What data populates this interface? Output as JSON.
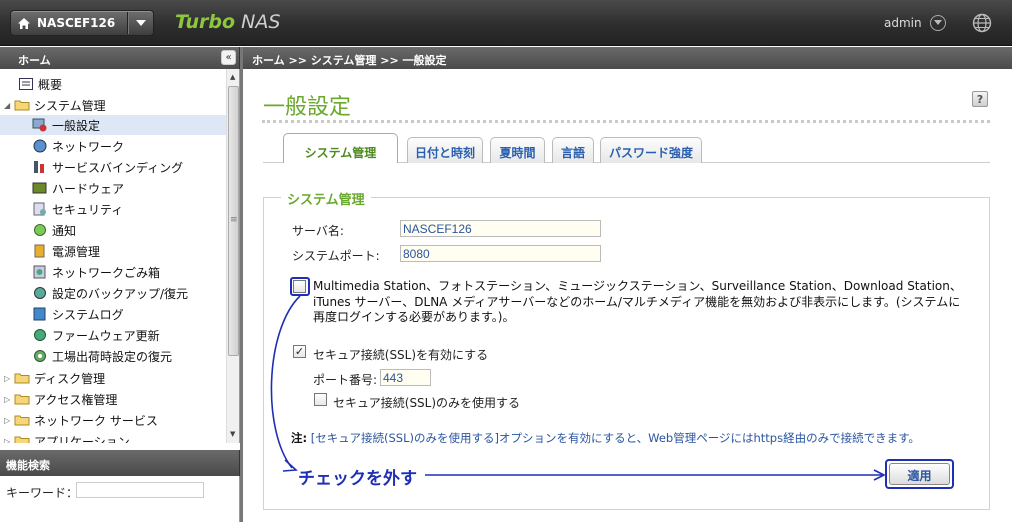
{
  "header": {
    "server_name": "NASCEF126",
    "brand_part1": "Turbo",
    "brand_part2": "NAS",
    "user": "admin"
  },
  "sidebar": {
    "title": "ホーム",
    "items": [
      {
        "label": "概要",
        "icon": "overview-icon"
      },
      {
        "label": "システム管理",
        "icon": "folder-open-icon",
        "expanded": true
      },
      {
        "label": "一般設定",
        "icon": "general-settings-icon",
        "selected": true
      },
      {
        "label": "ネットワーク",
        "icon": "network-icon"
      },
      {
        "label": "サービスバインディング",
        "icon": "service-binding-icon"
      },
      {
        "label": "ハードウェア",
        "icon": "hardware-icon"
      },
      {
        "label": "セキュリティ",
        "icon": "security-icon"
      },
      {
        "label": "通知",
        "icon": "notification-icon"
      },
      {
        "label": "電源管理",
        "icon": "power-icon"
      },
      {
        "label": "ネットワークごみ箱",
        "icon": "recycle-bin-icon"
      },
      {
        "label": "設定のバックアップ/復元",
        "icon": "backup-icon"
      },
      {
        "label": "システムログ",
        "icon": "system-log-icon"
      },
      {
        "label": "ファームウェア更新",
        "icon": "firmware-icon"
      },
      {
        "label": "工場出荷時設定の復元",
        "icon": "factory-reset-icon"
      },
      {
        "label": "ディスク管理",
        "icon": "folder-icon"
      },
      {
        "label": "アクセス権管理",
        "icon": "folder-icon"
      },
      {
        "label": "ネットワーク サービス",
        "icon": "folder-icon"
      },
      {
        "label": "アプリケーション",
        "icon": "folder-icon"
      }
    ],
    "advanced_search_title": "機能検索",
    "keyword_label": "キーワード：",
    "keyword_value": ""
  },
  "breadcrumb": "ホーム >> システム管理 >> 一般設定",
  "page_title": "一般設定",
  "tabs": [
    {
      "label": "システム管理",
      "active": true
    },
    {
      "label": "日付と時刻"
    },
    {
      "label": "夏時間"
    },
    {
      "label": "言語"
    },
    {
      "label": "パスワード強度"
    }
  ],
  "section": {
    "legend": "システム管理",
    "server_name_label": "サーバ名:",
    "server_name_value": "NASCEF126",
    "system_port_label": "システムポート:",
    "system_port_value": "8080",
    "multimedia_checked": false,
    "multimedia_text": "Multimedia Station、フォトステーション、ミュージックステーション、Surveillance Station、Download Station、iTunes サーバー、DLNA メディアサーバーなどのホーム/マルチメディア機能を無効および非表示にします。(システムに再度ログインする必要があります。)。",
    "ssl_checked": true,
    "ssl_label": "セキュア接続(SSL)を有効にする",
    "port_label": "ポート番号:",
    "port_value": "443",
    "ssl_only_checked": false,
    "ssl_only_label": "セキュア接続(SSL)のみを使用する",
    "note_prefix": "注:",
    "note_text": " [セキュア接続(SSL)のみを使用する]オプションを有効にすると、Web管理ページにはhttps経由のみで接続できます。",
    "apply_label": "適用"
  },
  "annotation": {
    "text": "チェックを外す",
    "color": "#1f2fb5"
  },
  "colors": {
    "accent_green": "#6aa82e",
    "link_blue": "#2a55a0"
  }
}
